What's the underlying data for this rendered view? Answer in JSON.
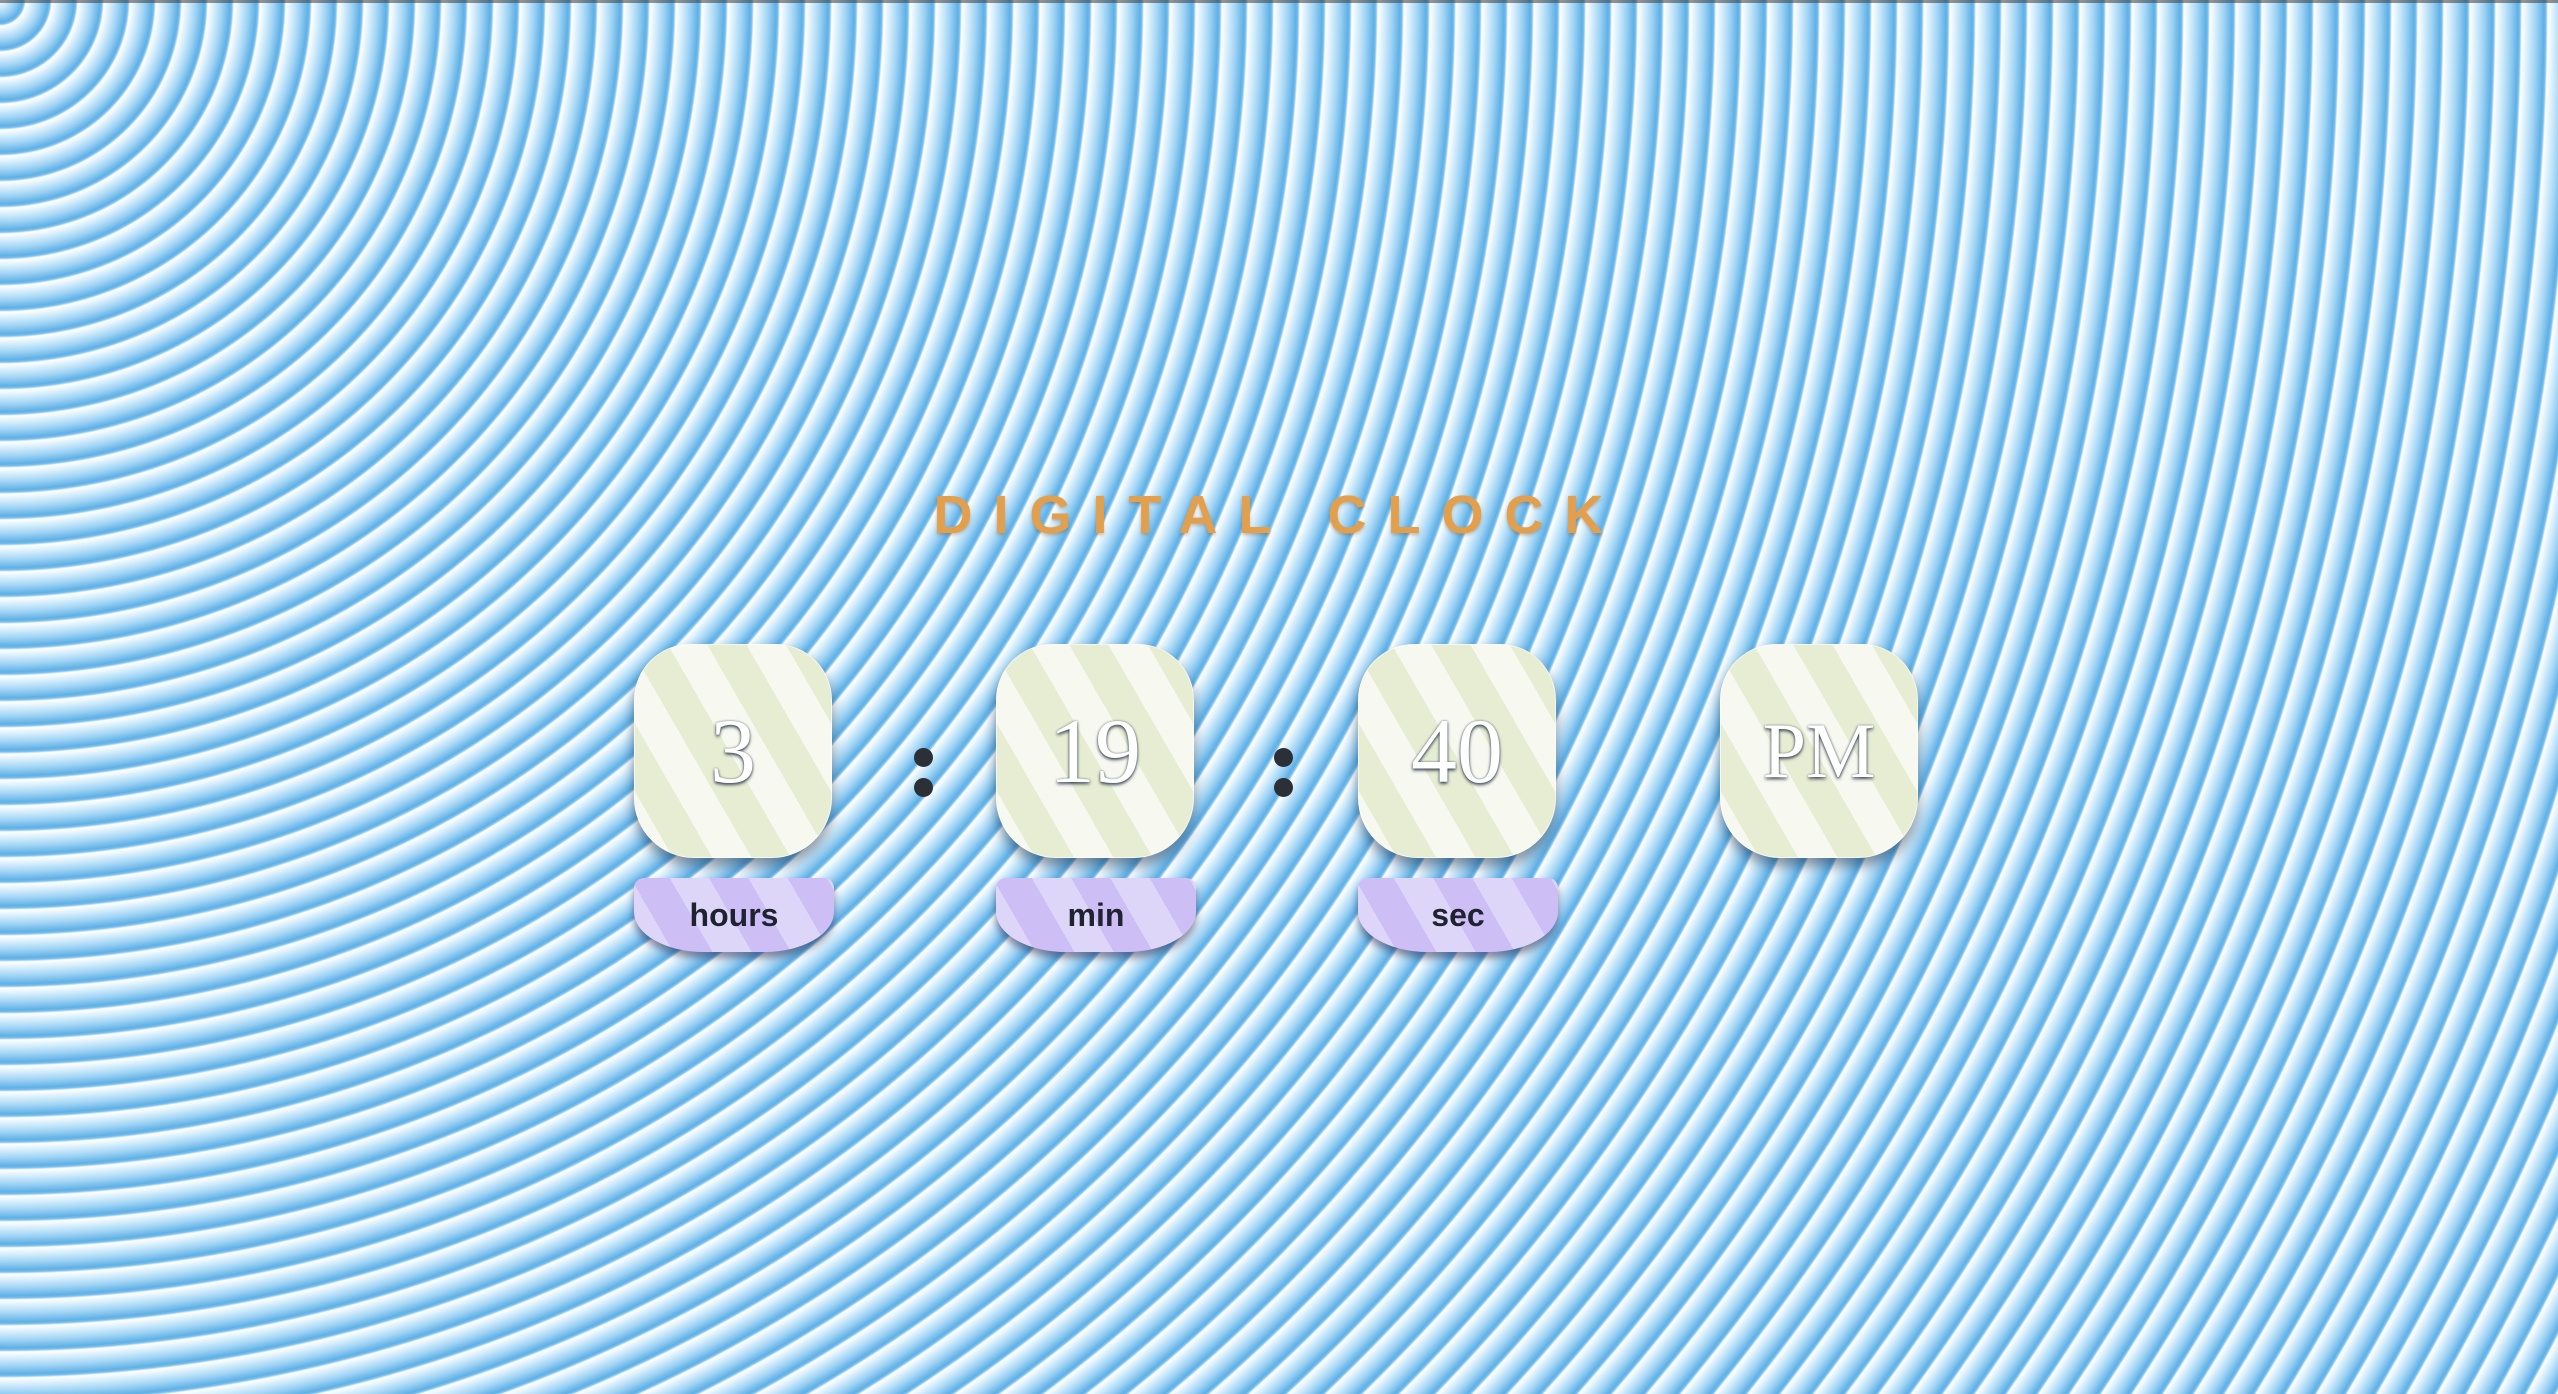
{
  "title": "DIGITAL CLOCK",
  "clock": {
    "hours": {
      "value": "3",
      "label": "hours"
    },
    "minutes": {
      "value": "19",
      "label": "min"
    },
    "seconds": {
      "value": "40",
      "label": "sec"
    },
    "period": {
      "value": "PM"
    },
    "separator": ":"
  },
  "colors": {
    "title": "#e2a04e",
    "digit_box": "#eef2de",
    "label_pill": "#d2c6f6",
    "background_stripe": "#5fb0e6"
  }
}
